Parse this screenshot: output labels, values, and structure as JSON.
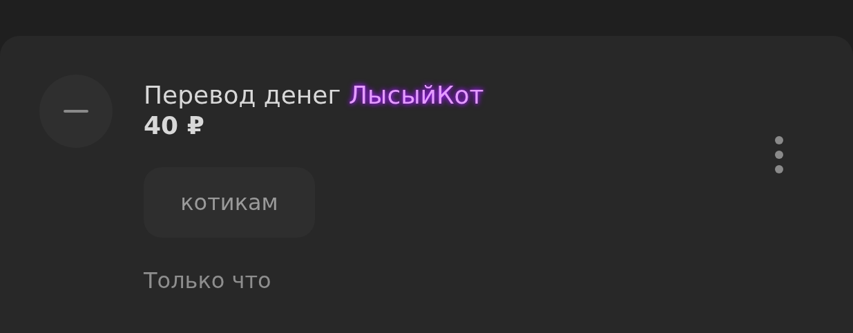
{
  "notification": {
    "title": "Перевод денег",
    "sender": "ЛысыйКот",
    "amount": "40 ₽",
    "message": "котикам",
    "time": "Только что"
  }
}
